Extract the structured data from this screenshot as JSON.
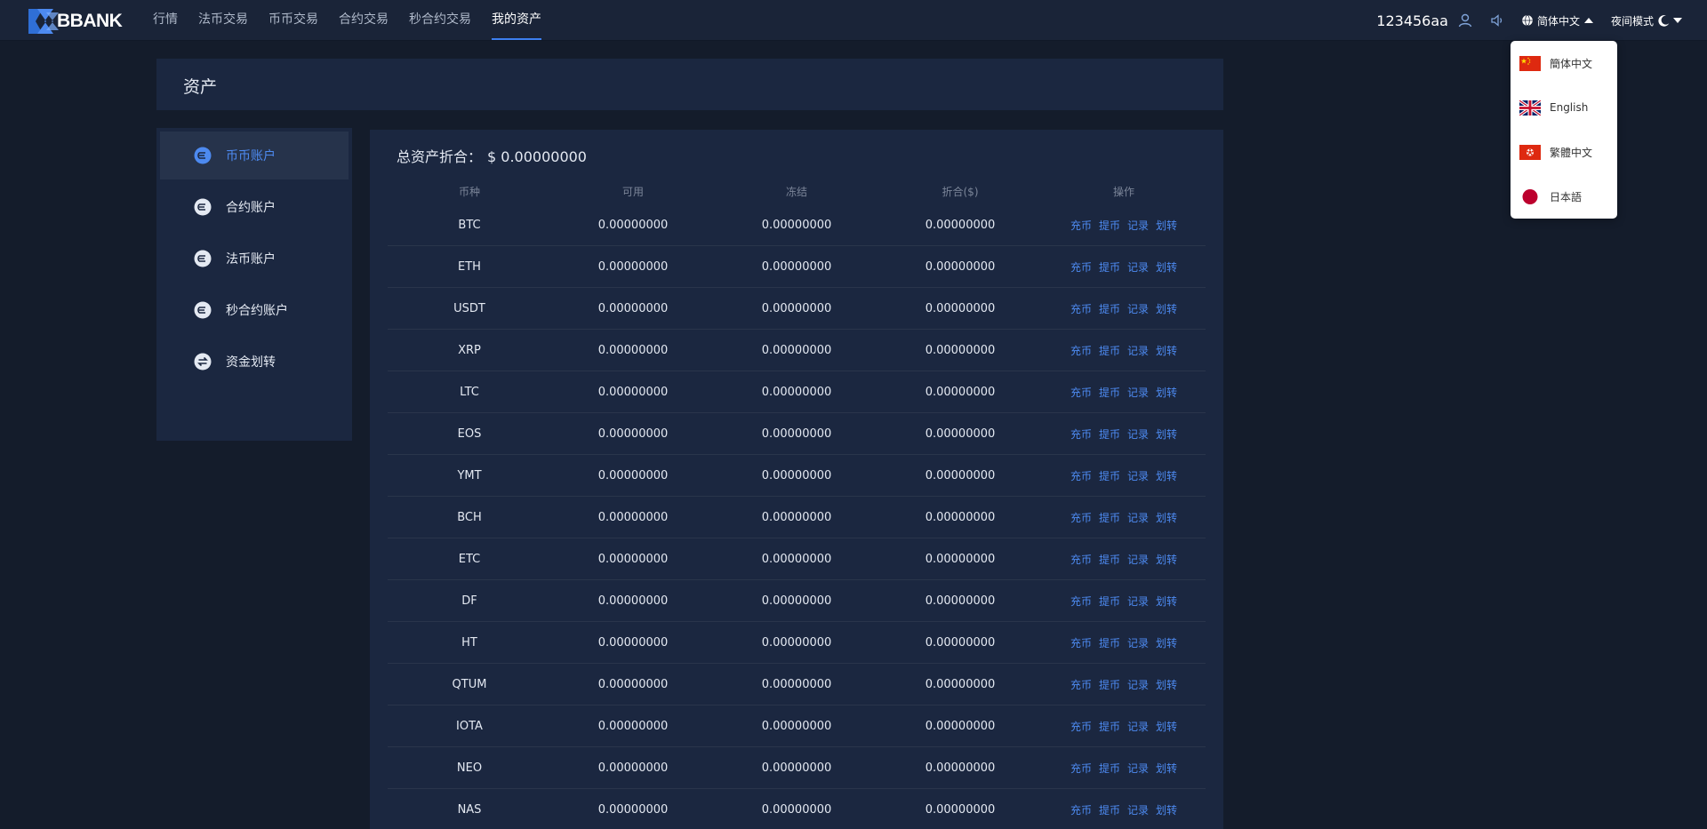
{
  "brand": {
    "name": "BBANK"
  },
  "nav": {
    "items": [
      {
        "label": "行情",
        "active": false
      },
      {
        "label": "法币交易",
        "active": false
      },
      {
        "label": "币币交易",
        "active": false
      },
      {
        "label": "合约交易",
        "active": false
      },
      {
        "label": "秒合约交易",
        "active": false
      },
      {
        "label": "我的资产",
        "active": true
      }
    ],
    "username": "123456aa",
    "language": "简体中文",
    "night_mode": "夜间模式"
  },
  "lang_dropdown": {
    "options": [
      {
        "label": "簡体中文",
        "flag": "cn-flag-icon"
      },
      {
        "label": "English",
        "flag": "uk-flag-icon"
      },
      {
        "label": "繁體中文",
        "flag": "hk-flag-icon"
      },
      {
        "label": "日本語",
        "flag": "jp-flag-icon"
      }
    ]
  },
  "page": {
    "title": "资产"
  },
  "sidebar": {
    "items": [
      {
        "label": "币币账户",
        "active": true
      },
      {
        "label": "合约账户",
        "active": false
      },
      {
        "label": "法币账户",
        "active": false
      },
      {
        "label": "秒合约账户",
        "active": false
      },
      {
        "label": "资金划转",
        "active": false
      }
    ]
  },
  "summary": {
    "label": "总资产折合：",
    "value": "$ 0.00000000"
  },
  "table": {
    "headers": [
      "币种",
      "可用",
      "冻结",
      "折合($)",
      "操作"
    ],
    "ops": [
      "充币",
      "提币",
      "记录",
      "划转"
    ],
    "rows": [
      {
        "coin": "BTC",
        "available": "0.00000000",
        "frozen": "0.00000000",
        "converted": "0.00000000"
      },
      {
        "coin": "ETH",
        "available": "0.00000000",
        "frozen": "0.00000000",
        "converted": "0.00000000"
      },
      {
        "coin": "USDT",
        "available": "0.00000000",
        "frozen": "0.00000000",
        "converted": "0.00000000"
      },
      {
        "coin": "XRP",
        "available": "0.00000000",
        "frozen": "0.00000000",
        "converted": "0.00000000"
      },
      {
        "coin": "LTC",
        "available": "0.00000000",
        "frozen": "0.00000000",
        "converted": "0.00000000"
      },
      {
        "coin": "EOS",
        "available": "0.00000000",
        "frozen": "0.00000000",
        "converted": "0.00000000"
      },
      {
        "coin": "YMT",
        "available": "0.00000000",
        "frozen": "0.00000000",
        "converted": "0.00000000"
      },
      {
        "coin": "BCH",
        "available": "0.00000000",
        "frozen": "0.00000000",
        "converted": "0.00000000"
      },
      {
        "coin": "ETC",
        "available": "0.00000000",
        "frozen": "0.00000000",
        "converted": "0.00000000"
      },
      {
        "coin": "DF",
        "available": "0.00000000",
        "frozen": "0.00000000",
        "converted": "0.00000000"
      },
      {
        "coin": "HT",
        "available": "0.00000000",
        "frozen": "0.00000000",
        "converted": "0.00000000"
      },
      {
        "coin": "QTUM",
        "available": "0.00000000",
        "frozen": "0.00000000",
        "converted": "0.00000000"
      },
      {
        "coin": "IOTA",
        "available": "0.00000000",
        "frozen": "0.00000000",
        "converted": "0.00000000"
      },
      {
        "coin": "NEO",
        "available": "0.00000000",
        "frozen": "0.00000000",
        "converted": "0.00000000"
      },
      {
        "coin": "NAS",
        "available": "0.00000000",
        "frozen": "0.00000000",
        "converted": "0.00000000"
      }
    ]
  },
  "colors": {
    "accent": "#4d8af0",
    "background": "#141c2b",
    "panel": "#1b2740"
  }
}
